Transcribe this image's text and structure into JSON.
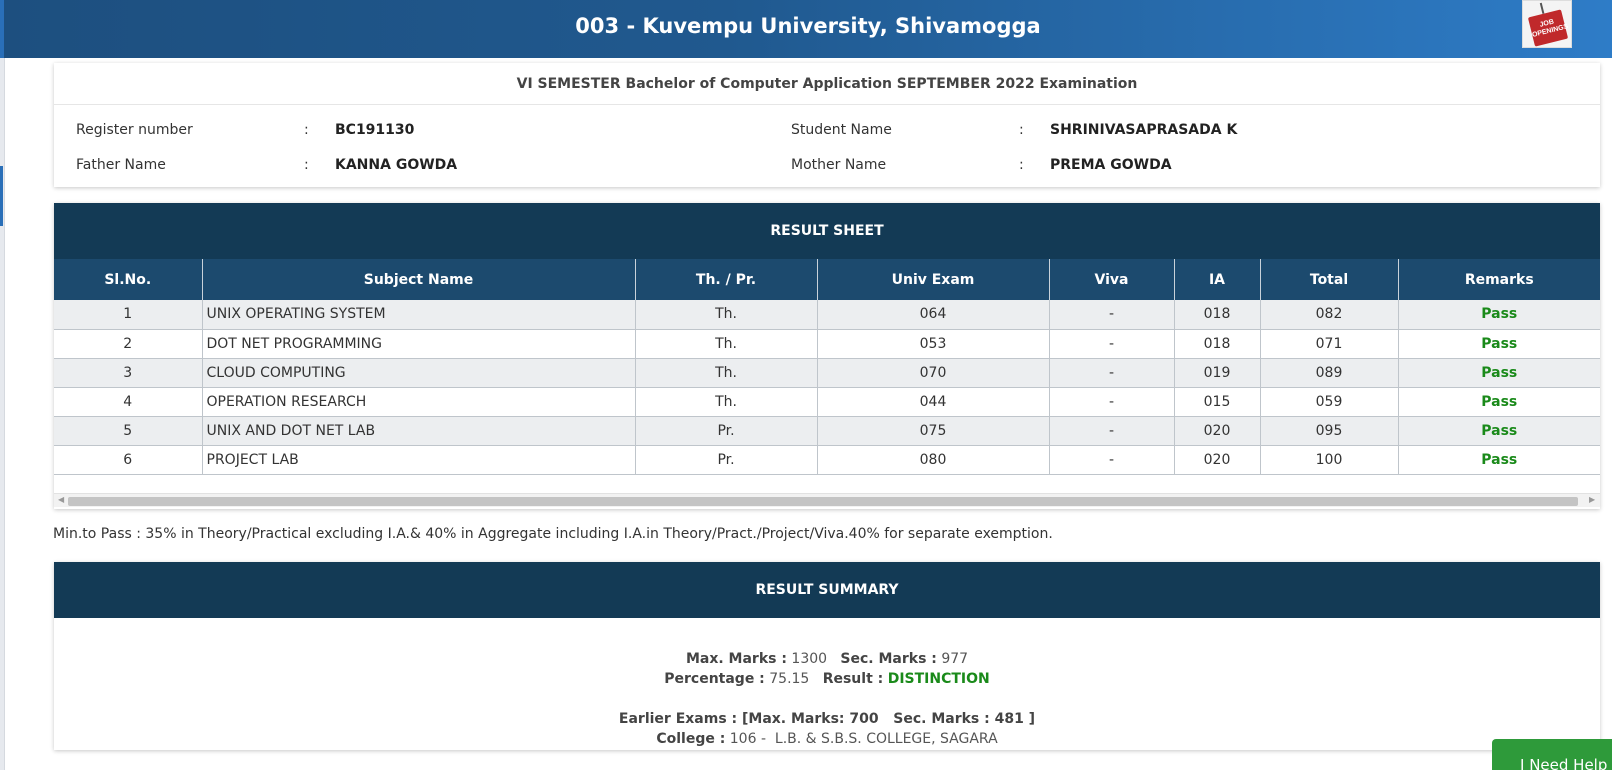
{
  "header": {
    "title": "003 - Kuvempu University, Shivamogga",
    "badge_text": "JOB OPENINGS"
  },
  "exam": {
    "title": "VI SEMESTER Bachelor of Computer Application SEPTEMBER 2022 Examination",
    "separator": ":",
    "register_label": "Register number",
    "register_value": "BC191130",
    "student_label": "Student Name",
    "student_value": "SHRINIVASAPRASADA K",
    "father_label": "Father Name",
    "father_value": "KANNA GOWDA",
    "mother_label": "Mother Name",
    "mother_value": "PREMA GOWDA"
  },
  "result_sheet": {
    "title": "RESULT SHEET",
    "columns": [
      "Sl.No.",
      "Subject Name",
      "Th. / Pr.",
      "Univ Exam",
      "Viva",
      "IA",
      "Total",
      "Remarks"
    ],
    "rows": [
      {
        "sl": "1",
        "subject": "UNIX OPERATING SYSTEM",
        "type": "Th.",
        "univ": "064",
        "viva": "-",
        "ia": "018",
        "total": "082",
        "remarks": "Pass"
      },
      {
        "sl": "2",
        "subject": "DOT NET PROGRAMMING",
        "type": "Th.",
        "univ": "053",
        "viva": "-",
        "ia": "018",
        "total": "071",
        "remarks": "Pass"
      },
      {
        "sl": "3",
        "subject": "CLOUD COMPUTING",
        "type": "Th.",
        "univ": "070",
        "viva": "-",
        "ia": "019",
        "total": "089",
        "remarks": "Pass"
      },
      {
        "sl": "4",
        "subject": "OPERATION RESEARCH",
        "type": "Th.",
        "univ": "044",
        "viva": "-",
        "ia": "015",
        "total": "059",
        "remarks": "Pass"
      },
      {
        "sl": "5",
        "subject": "UNIX AND DOT NET LAB",
        "type": "Pr.",
        "univ": "075",
        "viva": "-",
        "ia": "020",
        "total": "095",
        "remarks": "Pass"
      },
      {
        "sl": "6",
        "subject": "PROJECT LAB",
        "type": "Pr.",
        "univ": "080",
        "viva": "-",
        "ia": "020",
        "total": "100",
        "remarks": "Pass"
      }
    ]
  },
  "min_pass_note": "Min.to Pass : 35% in Theory/Practical excluding I.A.& 40% in Aggregate including I.A.in Theory/Pract./Project/Viva.40% for separate exemption.",
  "summary": {
    "title": "RESULT SUMMARY",
    "max_marks_label": "Max. Marks :",
    "max_marks_value": "1300",
    "sec_marks_label": "Sec. Marks :",
    "sec_marks_value": "977",
    "percentage_label": "Percentage :",
    "percentage_value": "75.15",
    "result_label": "Result :",
    "result_value": "DISTINCTION",
    "earlier_exams": "Earlier Exams : [Max. Marks: 700   Sec. Marks : 481 ]",
    "college_label": "College :",
    "college_value": "106 -  L.B. & S.B.S. COLLEGE, SAGARA"
  },
  "help_button": "I Need Help",
  "colors": {
    "header_start": "#1d4f7f",
    "header_end": "#2e7cc7",
    "section_head": "#133a55",
    "table_head": "#1c4a6e",
    "pass_green": "#1a8a1a",
    "help_green": "#2e9a3a"
  }
}
